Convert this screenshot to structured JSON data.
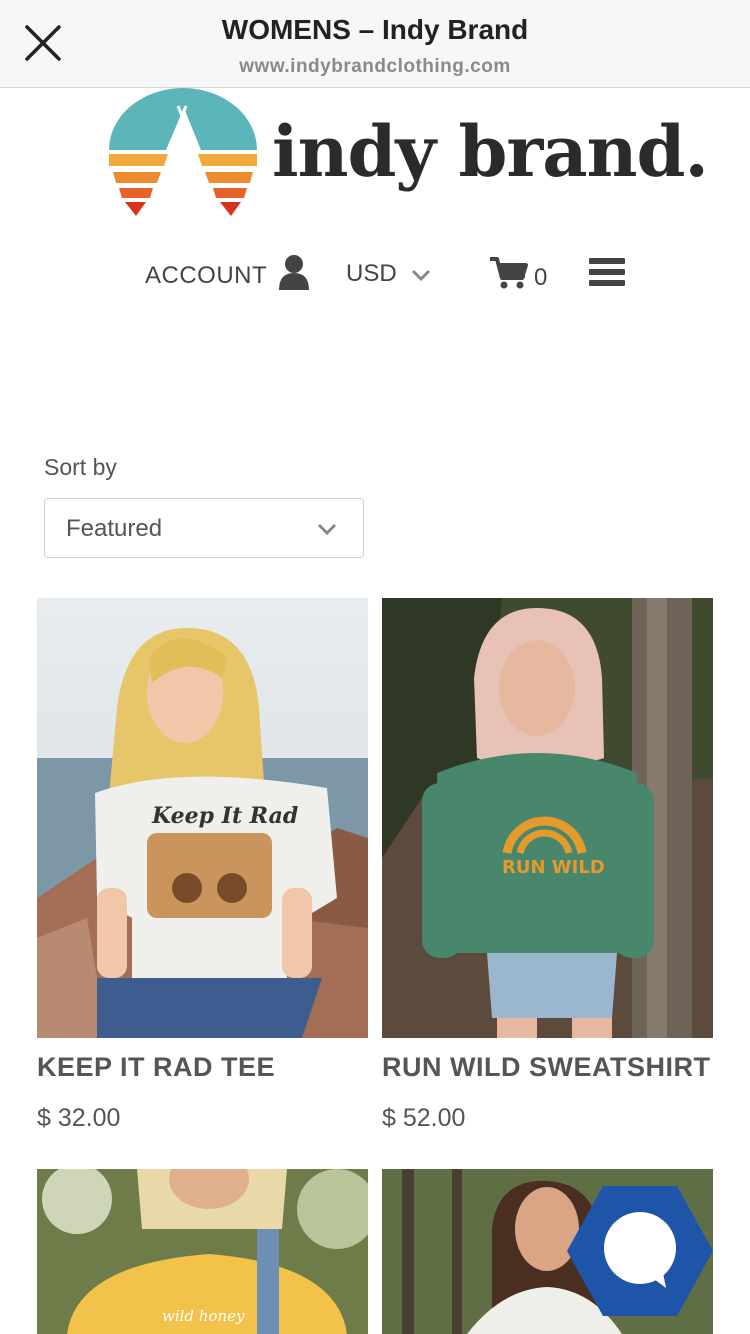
{
  "browser": {
    "title": "WOMENS – Indy Brand",
    "url": "www.indybrandclothing.com",
    "close_icon": "close-icon"
  },
  "logo": {
    "text": "indy brand.",
    "colors": {
      "sky": "#5cb6b9",
      "stripe1": "#f2a93b",
      "stripe2": "#ee8a2f",
      "stripe3": "#e8632b",
      "stripe4": "#d8331f"
    }
  },
  "header": {
    "account_label": "ACCOUNT",
    "account_icon": "person-icon",
    "currency": "USD",
    "cart_icon": "cart-icon",
    "cart_count": "0",
    "menu_icon": "hamburger-menu-icon"
  },
  "sort": {
    "label": "Sort by",
    "selected": "Featured"
  },
  "products": [
    {
      "name": "KEEP IT RAD TEE",
      "price": "$ 32.00",
      "shirt_print": "Keep It Rad"
    },
    {
      "name": "RUN WILD SWEATSHIRT",
      "price": "$ 52.00",
      "shirt_print": "RUN WILD"
    },
    {
      "name": "",
      "price": "",
      "shirt_print": "wild honey"
    },
    {
      "name": "",
      "price": "",
      "shirt_print": ""
    }
  ],
  "chat": {
    "icon": "chat-bubble-icon",
    "color": "#1f55a8"
  }
}
